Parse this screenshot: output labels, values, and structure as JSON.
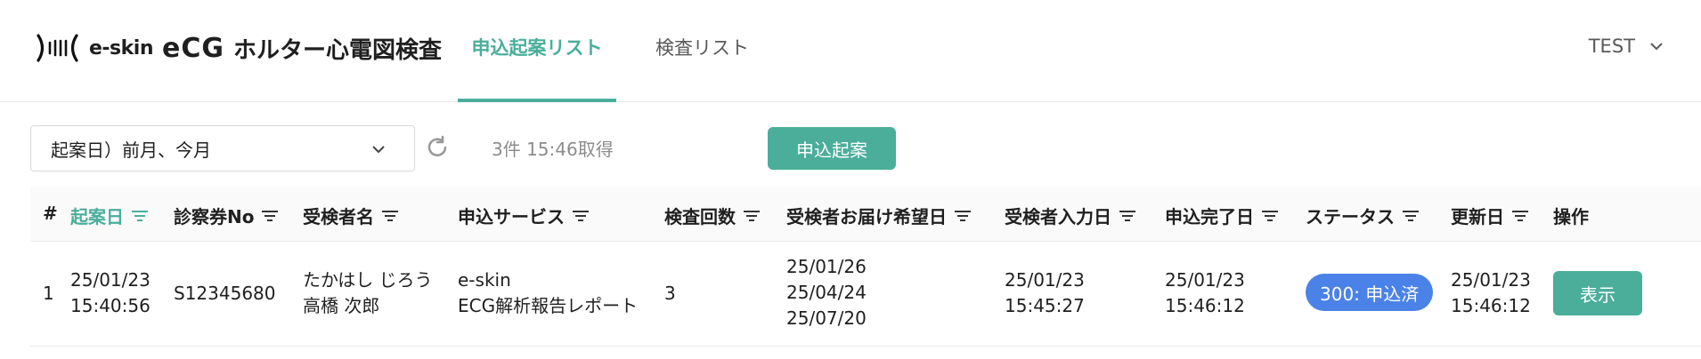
{
  "header": {
    "logo_eskin": "e-skin",
    "logo_ecg": "eCG",
    "logo_title": "ホルター心電図検査",
    "tabs": [
      {
        "label": "申込起案リスト",
        "active": true
      },
      {
        "label": "検査リスト",
        "active": false
      }
    ],
    "user": "TEST",
    "accent_color": "#4aae9b"
  },
  "toolbar": {
    "filter_value": "起案日）前月、今月",
    "fetch_info": "3件 15:46取得",
    "new_button": "申込起案"
  },
  "table": {
    "columns": [
      "#",
      "起案日",
      "診察券No",
      "受検者名",
      "申込サービス",
      "検査回数",
      "受検者お届け希望日",
      "受検者入力日",
      "申込完了日",
      "ステータス",
      "更新日",
      "操作"
    ],
    "rows": [
      {
        "index": "1",
        "draft_date": [
          "25/01/23",
          "15:40:56"
        ],
        "patient_no": "S12345680",
        "name": [
          "たかはし じろう",
          "高橋 次郎"
        ],
        "service": [
          "e-skin",
          "ECG解析報告レポート"
        ],
        "test_count": "3",
        "delivery_dates": [
          "25/01/26",
          "25/04/24",
          "25/07/20"
        ],
        "input_date": [
          "25/01/23",
          "15:45:27"
        ],
        "complete_date": [
          "25/01/23",
          "15:46:12"
        ],
        "status": "300: 申込済",
        "updated": [
          "25/01/23",
          "15:46:12"
        ],
        "action": "表示"
      }
    ]
  },
  "colors": {
    "status_badge": "#4b82e8",
    "primary": "#4aae9b"
  }
}
